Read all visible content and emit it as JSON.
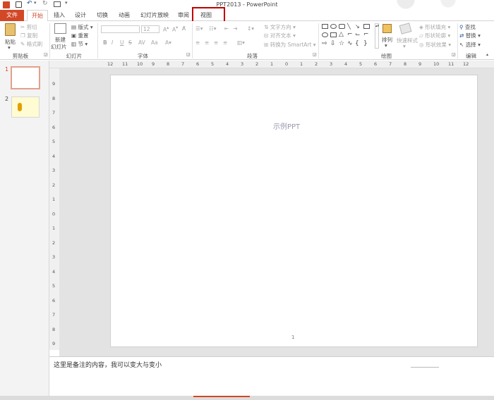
{
  "window": {
    "title": "PPT2013 - PowerPoint"
  },
  "qat": {
    "save": "save-icon",
    "undo": "undo-icon",
    "redo": "redo-icon",
    "customize": "customize-icon"
  },
  "tabs": [
    {
      "label": "文件",
      "active": false,
      "file": true
    },
    {
      "label": "开始",
      "active": true
    },
    {
      "label": "插入"
    },
    {
      "label": "设计"
    },
    {
      "label": "切换"
    },
    {
      "label": "动画"
    },
    {
      "label": "幻灯片放映"
    },
    {
      "label": "审阅"
    },
    {
      "label": "视图",
      "highlighted": true
    }
  ],
  "ribbon": {
    "clipboard": {
      "paste": "粘贴",
      "cut": "剪切",
      "copy": "复制",
      "format_painter": "格式刷",
      "group": "剪贴板"
    },
    "slides": {
      "new_slide_1": "新建",
      "new_slide_2": "幻灯片",
      "layout": "版式",
      "reset": "重置",
      "section": "节",
      "group": "幻灯片"
    },
    "font": {
      "size": "12",
      "group": "字体",
      "bold": "B",
      "italic": "I",
      "underline": "U",
      "strike": "S"
    },
    "paragraph": {
      "text_direction": "文字方向",
      "align_text": "对齐文本",
      "smartart": "转换为 SmartArt",
      "group": "段落"
    },
    "drawing": {
      "arrange": "排列",
      "quick_styles": "快速样式",
      "fill": "形状填充",
      "outline": "形状轮廓",
      "effects": "形状效果",
      "group": "绘图"
    },
    "editing": {
      "find": "查找",
      "replace": "替换",
      "select": "选择",
      "group": "编辑"
    }
  },
  "ruler": {
    "top_labels": [
      "12",
      "11",
      "10",
      "9",
      "8",
      "7",
      "6",
      "5",
      "4",
      "3",
      "2",
      "1",
      "0",
      "1",
      "2",
      "3",
      "4",
      "5",
      "6",
      "7",
      "8",
      "9",
      "10",
      "11",
      "12"
    ],
    "left_labels": [
      "9",
      "8",
      "7",
      "6",
      "5",
      "4",
      "3",
      "2",
      "1",
      "0",
      "1",
      "2",
      "3",
      "4",
      "5",
      "6",
      "7",
      "8",
      "9"
    ]
  },
  "thumbnails": [
    {
      "number": "1"
    },
    {
      "number": "2"
    }
  ],
  "slide": {
    "title": "示例PPT",
    "page_number": "1"
  },
  "notes": {
    "text": "这里是备注的内容，我可以变大与变小"
  },
  "colors": {
    "accent": "#d24726",
    "highlight_box": "#c00000"
  }
}
